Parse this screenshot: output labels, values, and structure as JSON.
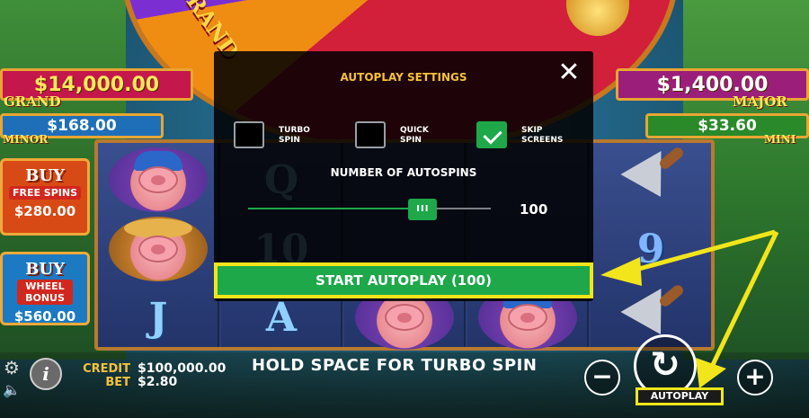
{
  "wheel": {
    "grand_text": "GRAND"
  },
  "jackpots": {
    "grand": {
      "value": "$14,000.00",
      "label": "GRAND",
      "color": "#c4174c"
    },
    "minor": {
      "value": "$168.00",
      "label": "MINOR",
      "color": "#1f6fb8"
    },
    "major": {
      "value": "$1,400.00",
      "label": "MAJOR",
      "color": "#9b1f7a"
    },
    "mini": {
      "value": "$33.60",
      "label": "MINI",
      "color": "#2a8a2a"
    }
  },
  "buy_buttons": [
    {
      "word": "BUY",
      "sub": "FREE SPINS",
      "price": "$280.00",
      "color": "#d84a15"
    },
    {
      "word": "BUY",
      "sub": "WHEEL BONUS",
      "price": "$560.00",
      "color": "#1c7ac2"
    }
  ],
  "reel_symbols": {
    "col1": [
      "pig-construction",
      "pig-farmer",
      "J"
    ],
    "col2": [
      "Q",
      "10",
      "A"
    ],
    "col5": [
      "trowel",
      "9",
      "trowel"
    ]
  },
  "symbols_text": {
    "j": "J",
    "q": "Q",
    "ten": "10",
    "a": "A",
    "nine": "9"
  },
  "modal": {
    "title": "AUTOPLAY SETTINGS",
    "close_icon": "close-icon",
    "options": [
      {
        "label_line1": "TURBO",
        "label_line2": "SPIN",
        "checked": false
      },
      {
        "label_line1": "QUICK",
        "label_line2": "SPIN",
        "checked": false
      },
      {
        "label_line1": "SKIP",
        "label_line2": "SCREENS",
        "checked": true
      }
    ],
    "spins_title": "NUMBER OF AUTOSPINS",
    "slider_thumb": "III",
    "slider_value": "100",
    "slider_fraction": 0.72,
    "start_label": "START AUTOPLAY (100)"
  },
  "bottom": {
    "credit_label": "CREDIT",
    "credit_value": "$100,000.00",
    "bet_label": "BET",
    "bet_value": "$2.80",
    "hint": "HOLD SPACE FOR TURBO SPIN",
    "minus": "−",
    "plus": "+",
    "spin_icon": "↻",
    "autoplay_label": "AUTOPLAY",
    "info": "i",
    "gear": "⚙",
    "speaker": "🔈"
  },
  "colors": {
    "accent_green": "#1ea84a",
    "highlight_yellow": "#f3e51b",
    "label_gold": "#f6c23a"
  }
}
